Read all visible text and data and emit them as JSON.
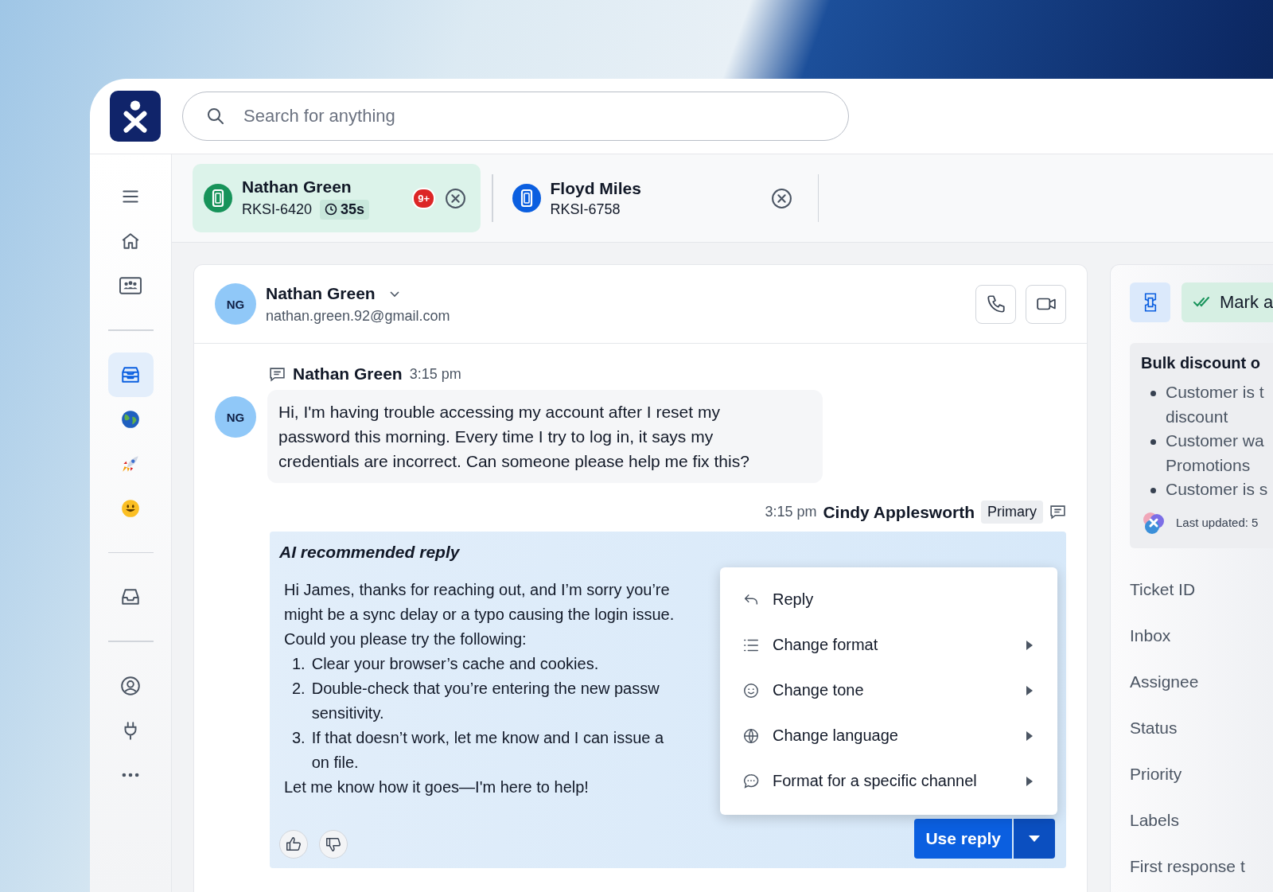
{
  "search": {
    "placeholder": "Search for anything"
  },
  "sidebar": {
    "groups": [
      [
        {
          "kind": "menu",
          "selected": false
        },
        {
          "kind": "home",
          "selected": false
        },
        {
          "kind": "contacts",
          "selected": false
        }
      ],
      [
        {
          "kind": "inbox",
          "selected": true
        },
        {
          "kind": "globe",
          "selected": false
        },
        {
          "kind": "rocket",
          "selected": false
        },
        {
          "kind": "smiley",
          "selected": false
        }
      ],
      [
        {
          "kind": "tray",
          "selected": false
        }
      ],
      [
        {
          "kind": "user",
          "selected": false
        },
        {
          "kind": "plug",
          "selected": false
        },
        {
          "kind": "more",
          "selected": false
        }
      ]
    ]
  },
  "tabs": [
    {
      "name": "Nathan Green",
      "ticket": "RKSI-6420",
      "timer": "35s",
      "badge": "9+",
      "color": "#17935a",
      "selected": true
    },
    {
      "name": "Floyd Miles",
      "ticket": "RKSI-6758",
      "color": "#0b5fe0",
      "selected": false
    }
  ],
  "contact": {
    "initials": "NG",
    "name": "Nathan Green",
    "email": "nathan.green.92@gmail.com"
  },
  "message": {
    "author": "Nathan Green",
    "time": "3:15 pm",
    "initials": "NG",
    "text": "Hi, I'm having trouble accessing my account after I reset my password this morning. Every time I try to log in, it says my credentials are incorrect. Can someone please help me fix this?"
  },
  "agent": {
    "time": "3:15 pm",
    "name": "Cindy Applesworth",
    "role": "Primary"
  },
  "ai_reply": {
    "title": "AI recommended reply",
    "lines": [
      {
        "kind": "text",
        "text": "Hi James, thanks for reaching out, and I’m sorry you’re"
      },
      {
        "kind": "text",
        "text": "might be a sync delay or a typo causing the login issue."
      },
      {
        "kind": "text",
        "text": "Could you please try the following:"
      },
      {
        "kind": "item",
        "number": "1.",
        "lines": [
          "Clear your browser’s cache and cookies."
        ]
      },
      {
        "kind": "item",
        "number": "2.",
        "lines": [
          "Double-check that you’re entering the new passw",
          "sensitivity."
        ]
      },
      {
        "kind": "item",
        "number": "3.",
        "lines": [
          "If that doesn’t work, let me know and I can issue a",
          "on file."
        ]
      },
      {
        "kind": "text",
        "text": "Let me know how it goes—I'm here to help!"
      }
    ],
    "button": "Use reply"
  },
  "menu": [
    {
      "kind": "reply",
      "label": "Reply",
      "submenu": false
    },
    {
      "kind": "format",
      "label": "Change format",
      "submenu": true
    },
    {
      "kind": "tone",
      "label": "Change tone",
      "submenu": true
    },
    {
      "kind": "language",
      "label": "Change language",
      "submenu": true
    },
    {
      "kind": "channel",
      "label": "Format for a specific channel",
      "submenu": true
    }
  ],
  "details": {
    "mark_button": "Mark a",
    "summary": {
      "title": "Bulk discount o",
      "bullets": [
        [
          "Customer is t",
          "discount"
        ],
        [
          "Customer wa",
          "Promotions"
        ],
        [
          "Customer is s"
        ]
      ],
      "updated": "Last updated: 5"
    },
    "fields": [
      "Ticket ID",
      "Inbox",
      "Assignee",
      "Status",
      "Priority",
      "Labels",
      "First response t"
    ]
  }
}
